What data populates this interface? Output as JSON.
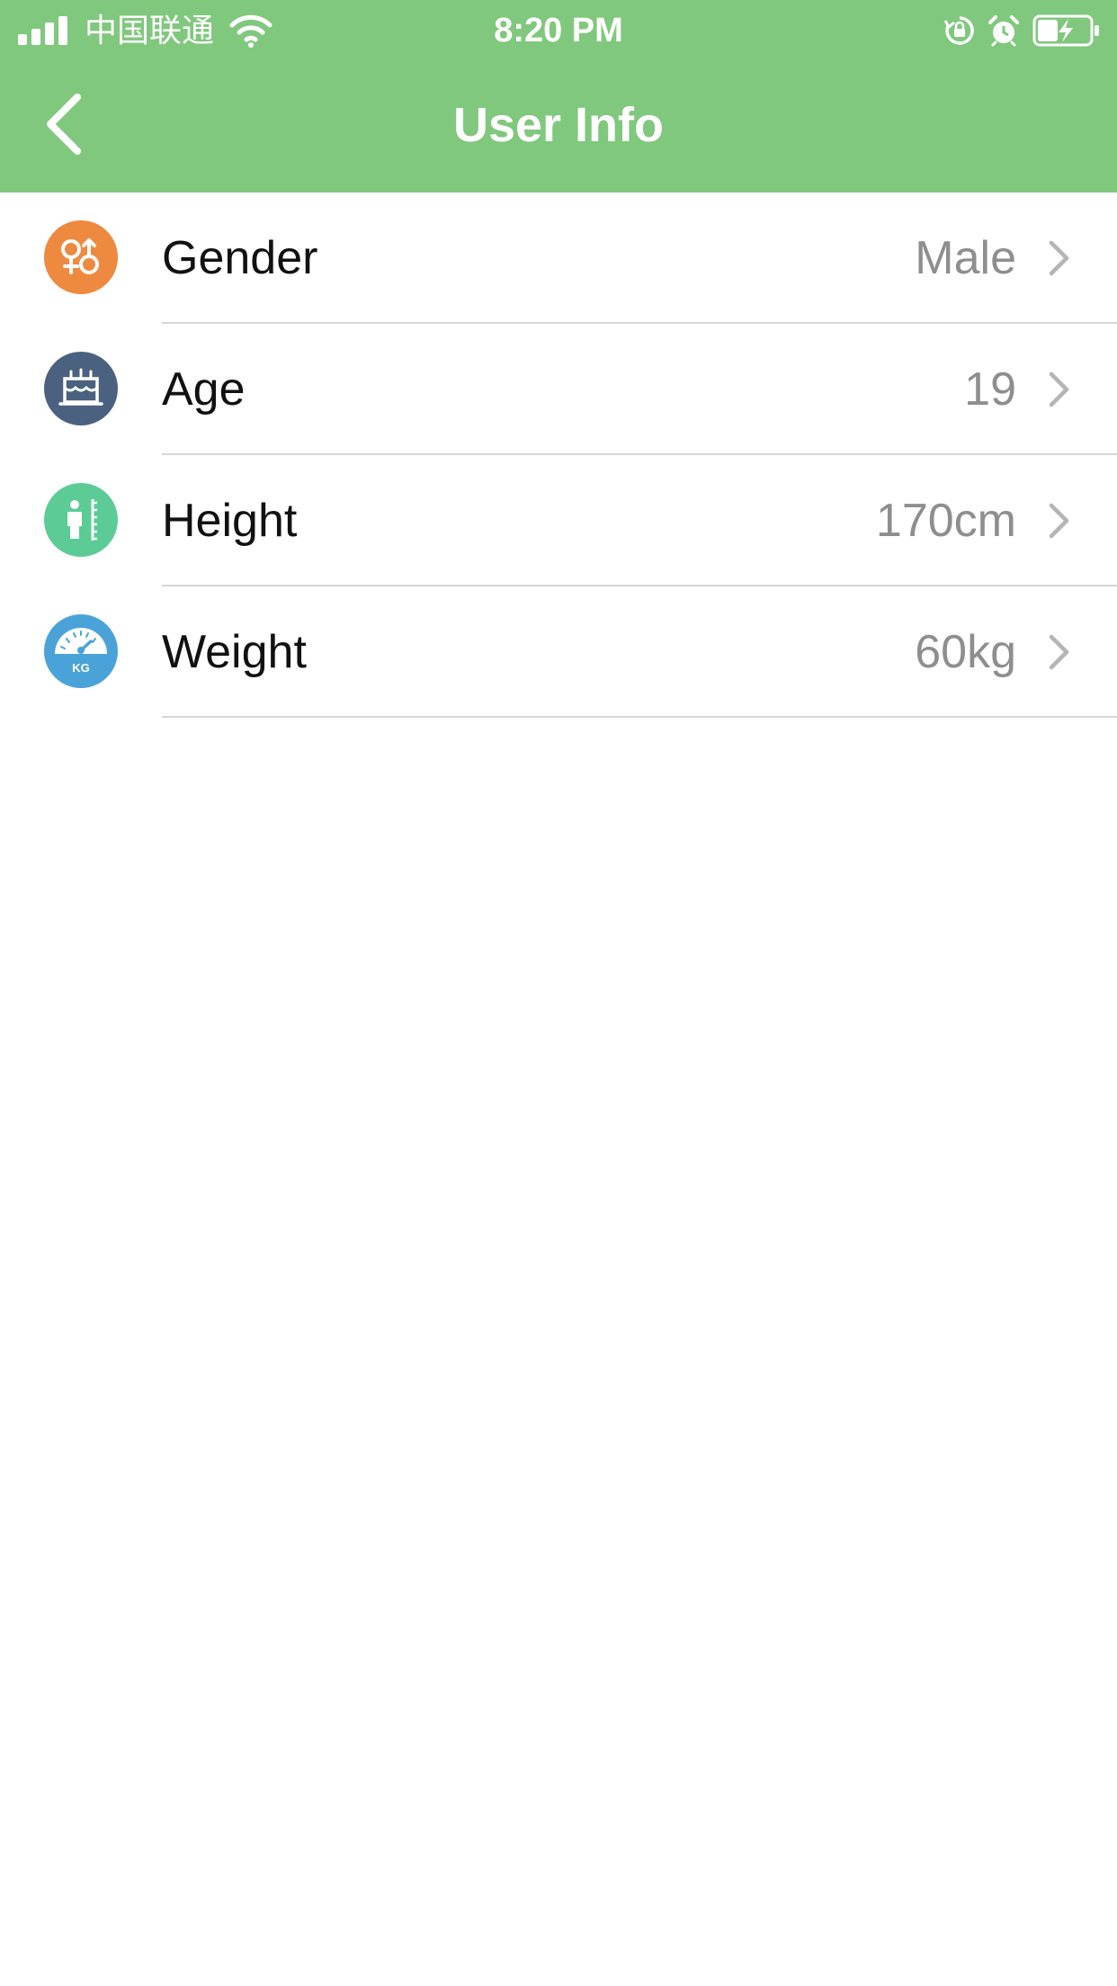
{
  "status_bar": {
    "carrier": "中国联通",
    "time": "8:20 PM",
    "icons": [
      "signal-icon",
      "wifi-icon",
      "rotation-lock-icon",
      "alarm-icon",
      "battery-charging-icon"
    ]
  },
  "nav": {
    "back_icon": "chevron-left-icon",
    "title": "User Info"
  },
  "colors": {
    "header_bg": "#80c87d",
    "gender_icon": "#ee8a3f",
    "age_icon": "#4b6180",
    "height_icon": "#5ccb96",
    "weight_icon": "#4aa3d8"
  },
  "rows": [
    {
      "label": "Gender",
      "value": "Male",
      "icon": "gender-icon"
    },
    {
      "label": "Age",
      "value": "19",
      "icon": "birthday-cake-icon"
    },
    {
      "label": "Height",
      "value": "170cm",
      "icon": "height-icon"
    },
    {
      "label": "Weight",
      "value": "60kg",
      "icon": "weight-scale-icon",
      "icon_text": "KG"
    }
  ]
}
